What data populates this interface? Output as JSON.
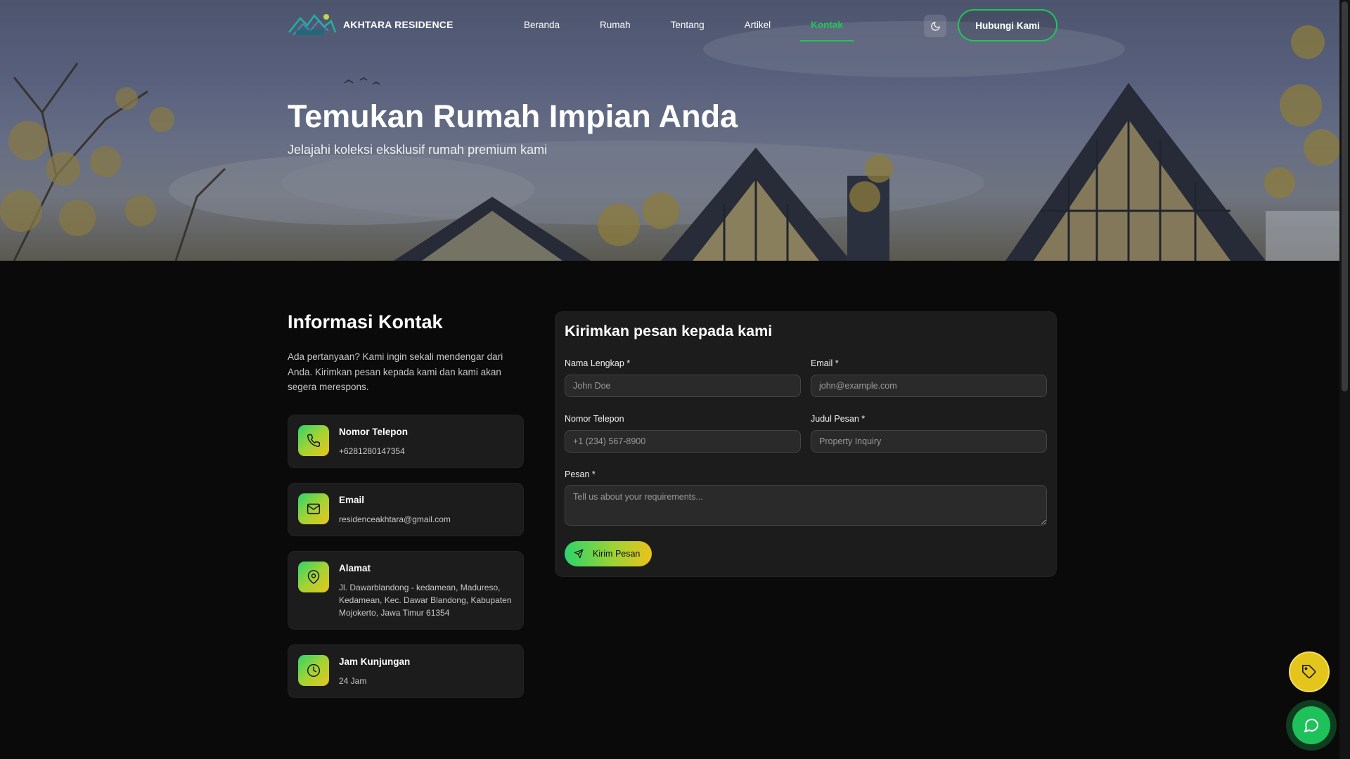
{
  "nav": {
    "brand": "AKHTARA RESIDENCE",
    "links": [
      "Beranda",
      "Rumah",
      "Tentang",
      "Artikel",
      "Kontak"
    ],
    "active_link": "Kontak",
    "cta_label": "Hubungi Kami",
    "theme_icon": "moon-icon"
  },
  "hero": {
    "title": "Temukan Rumah Impian Anda",
    "subtitle": "Jelajahi koleksi eksklusif rumah premium kami"
  },
  "info": {
    "title": "Informasi Kontak",
    "description": "Ada pertanyaan? Kami ingin sekali mendengar dari Anda. Kirimkan pesan kepada kami dan kami akan segera merespons.",
    "cards": [
      {
        "icon": "phone-icon",
        "title": "Nomor Telepon",
        "value": "+6281280147354"
      },
      {
        "icon": "mail-icon",
        "title": "Email",
        "value": "residenceakhtara@gmail.com"
      },
      {
        "icon": "map-pin-icon",
        "title": "Alamat",
        "value": "Jl. Dawarblandong - kedamean, Madureso, Kedamean, Kec. Dawar Blandong, Kabupaten Mojokerto, Jawa Timur 61354"
      },
      {
        "icon": "clock-icon",
        "title": "Jam Kunjungan",
        "value": "24 Jam"
      }
    ]
  },
  "form": {
    "title": "Kirimkan pesan kepada kami",
    "name_label": "Nama Lengkap *",
    "name_placeholder": "John Doe",
    "email_label": "Email *",
    "email_placeholder": "john@example.com",
    "phone_label": "Nomor Telepon",
    "phone_placeholder": "+1 (234) 567-8900",
    "subject_label": "Judul Pesan *",
    "subject_placeholder": "Property Inquiry",
    "message_label": "Pesan *",
    "message_placeholder": "Tell us about your requirements...",
    "submit_label": "Kirim Pesan"
  },
  "floating": {
    "tag_icon": "tag-icon",
    "chat_icon": "chat-icon"
  },
  "colors": {
    "accent_green": "#21c45a",
    "accent_yellow": "#e4c51c",
    "background": "#0a0a0a",
    "card": "#1c1c1c"
  }
}
